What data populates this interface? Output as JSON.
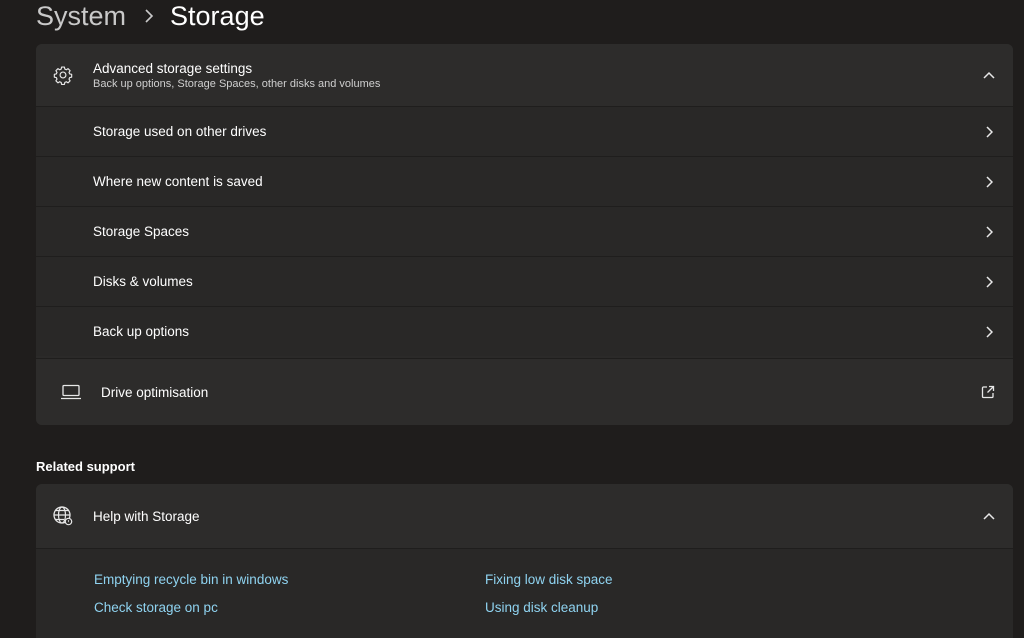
{
  "breadcrumb": {
    "parent": "System",
    "current": "Storage"
  },
  "advanced": {
    "title": "Advanced storage settings",
    "subtitle": "Back up options, Storage Spaces, other disks and volumes",
    "items": [
      {
        "label": "Storage used on other drives"
      },
      {
        "label": "Where new content is saved"
      },
      {
        "label": "Storage Spaces"
      },
      {
        "label": "Disks & volumes"
      },
      {
        "label": "Back up options"
      }
    ]
  },
  "drive_optimisation": {
    "label": "Drive optimisation"
  },
  "related_support": {
    "heading": "Related support",
    "help_title": "Help with Storage",
    "links": [
      {
        "label": "Emptying recycle bin in windows"
      },
      {
        "label": "Fixing low disk space"
      },
      {
        "label": "Check storage on pc"
      },
      {
        "label": "Using disk cleanup"
      }
    ]
  },
  "colors": {
    "background": "#1f1d1c",
    "card": "#2b2a29",
    "link": "#8fd3f0"
  }
}
